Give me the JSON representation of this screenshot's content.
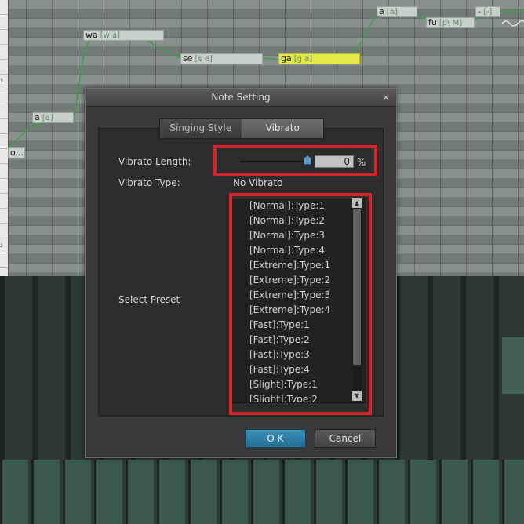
{
  "roll": {
    "notes": [
      {
        "lyric": "wa",
        "phonemes": "[w a]"
      },
      {
        "lyric": "se",
        "phonemes": "[s e]"
      },
      {
        "lyric": "ga",
        "phonemes": "[g a]"
      },
      {
        "lyric": "a",
        "phonemes": "[a]"
      },
      {
        "lyric": "a",
        "phonemes": "[a]"
      },
      {
        "lyric": "fu",
        "phonemes": "[p\\ M]"
      },
      {
        "lyric": "-",
        "phonemes": "[-]"
      },
      {
        "lyric": "o...",
        "phonemes": ""
      }
    ],
    "selected_note_color": "#e4e84a",
    "pitch_color": "#3ea04a"
  },
  "dialog": {
    "title": "Note Setting",
    "close_glyph": "×",
    "tabs": [
      {
        "label": "Singing Style",
        "active": false
      },
      {
        "label": "Vibrato",
        "active": true
      }
    ],
    "vibrato_length_label": "Vibrato Length:",
    "vibrato_length_value": "0",
    "vibrato_length_unit": "%",
    "vibrato_length_fraction": 1.0,
    "vibrato_type_label": "Vibrato Type:",
    "vibrato_type_value": "No Vibrato",
    "select_preset_label": "Select Preset",
    "presets": [
      "[Normal]:Type:1",
      "[Normal]:Type:2",
      "[Normal]:Type:3",
      "[Normal]:Type:4",
      "[Extreme]:Type:1",
      "[Extreme]:Type:2",
      "[Extreme]:Type:3",
      "[Extreme]:Type:4",
      "[Fast]:Type:1",
      "[Fast]:Type:2",
      "[Fast]:Type:3",
      "[Fast]:Type:4",
      "[Slight]:Type:1",
      "[Slight]:Type:2"
    ],
    "ok_label": "O K",
    "cancel_label": "Cancel",
    "accent_color": "#2d82ad",
    "highlight_color": "#d8222a"
  }
}
